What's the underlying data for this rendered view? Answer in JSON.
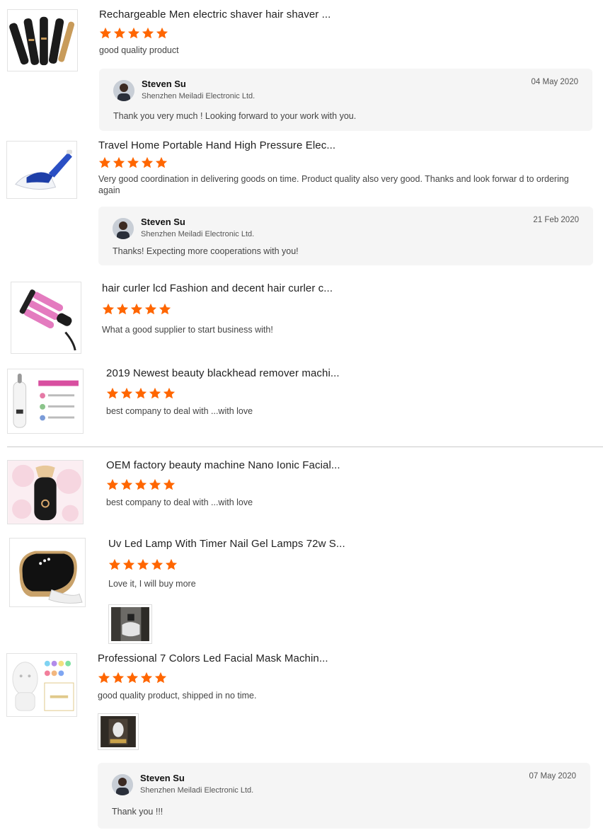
{
  "colors": {
    "star": "#ff6600",
    "reply_bg": "#f5f5f5",
    "divider": "#c9c9c9"
  },
  "reviews": [
    {
      "title": "Rechargeable Men electric shaver hair shaver ...",
      "rating": 5,
      "comment": "good quality product",
      "reply": {
        "name": "Steven Su",
        "company": "Shenzhen Meiladi Electronic Ltd.",
        "date": "04 May 2020",
        "text": "Thank you very much ! Looking forward to your work with you."
      }
    },
    {
      "title": "Travel Home Portable Hand High Pressure Elec...",
      "rating": 5,
      "comment": "Very good coordination in delivering goods on time. Product quality also very good. Thanks and look forwar d to ordering again",
      "reply": {
        "name": "Steven Su",
        "company": "Shenzhen Meiladi Electronic Ltd.",
        "date": "21 Feb 2020",
        "text": "Thanks! Expecting more cooperations with you!"
      }
    },
    {
      "title": "hair curler lcd Fashion and decent hair curler c...",
      "rating": 5,
      "comment": "What a good supplier to start business with!"
    },
    {
      "title": "2019 Newest beauty blackhead remover machi...",
      "rating": 5,
      "comment": "best company to deal with ...with love"
    },
    {
      "title": "OEM factory beauty machine Nano Ionic Facial...",
      "rating": 5,
      "comment": "best company to deal with ...with love"
    },
    {
      "title": "Uv Led Lamp With Timer Nail Gel Lamps 72w S...",
      "rating": 5,
      "comment": "Love it, I will buy more"
    },
    {
      "title": "Professional 7 Colors Led Facial Mask Machin...",
      "rating": 5,
      "comment": "good quality product, shipped in no time.",
      "reply": {
        "name": "Steven Su",
        "company": "Shenzhen Meiladi Electronic Ltd.",
        "date": "07 May 2020",
        "text": "Thank you !!!"
      }
    }
  ]
}
